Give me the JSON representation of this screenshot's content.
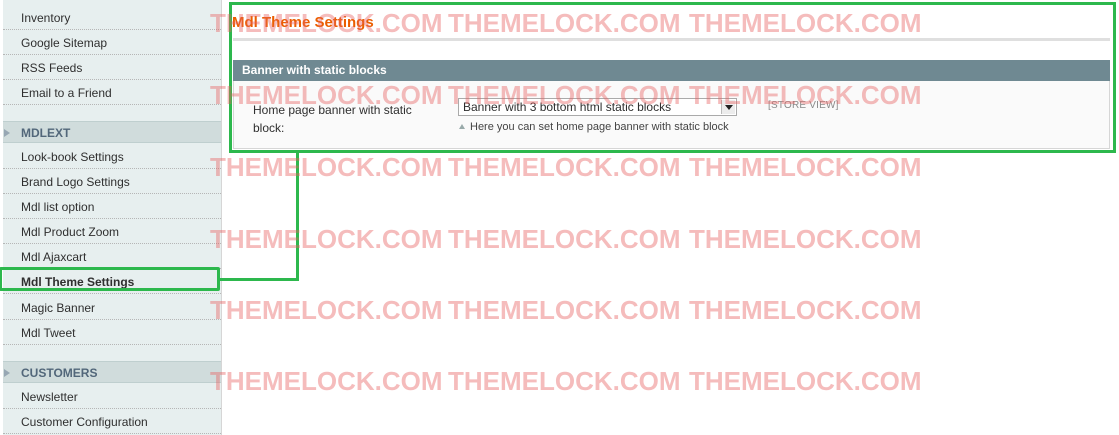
{
  "sidebar": {
    "items_top": [
      {
        "label": "Inventory"
      },
      {
        "label": "Google Sitemap"
      },
      {
        "label": "RSS Feeds"
      },
      {
        "label": "Email to a Friend"
      }
    ],
    "section_mdlext": "MDLEXT",
    "items_mdlext": [
      {
        "label": "Look-book Settings"
      },
      {
        "label": "Brand Logo Settings"
      },
      {
        "label": "Mdl list option"
      },
      {
        "label": "Mdl Product Zoom"
      },
      {
        "label": "Mdl Ajaxcart"
      },
      {
        "label": "Mdl Theme Settings"
      },
      {
        "label": "Magic Banner"
      },
      {
        "label": "Mdl Tweet"
      }
    ],
    "section_customers": "CUSTOMERS",
    "items_customers": [
      {
        "label": "Newsletter"
      },
      {
        "label": "Customer Configuration"
      }
    ]
  },
  "main": {
    "title": "Mdl Theme Settings",
    "fieldset_title": "Banner with static blocks",
    "field_label": "Home page banner with static block:",
    "select_value": "Banner with 3 bottom html static blocks",
    "scope": "[STORE VIEW]",
    "note": "Here you can set home page banner with static block"
  },
  "watermark": "THEMELOCK.COM",
  "colors": {
    "highlight": "#2db84d",
    "title": "#eb5e00",
    "fieldset_header": "#6f8992",
    "sidebar_bg": "#e7efef",
    "watermark": "#e86060"
  }
}
